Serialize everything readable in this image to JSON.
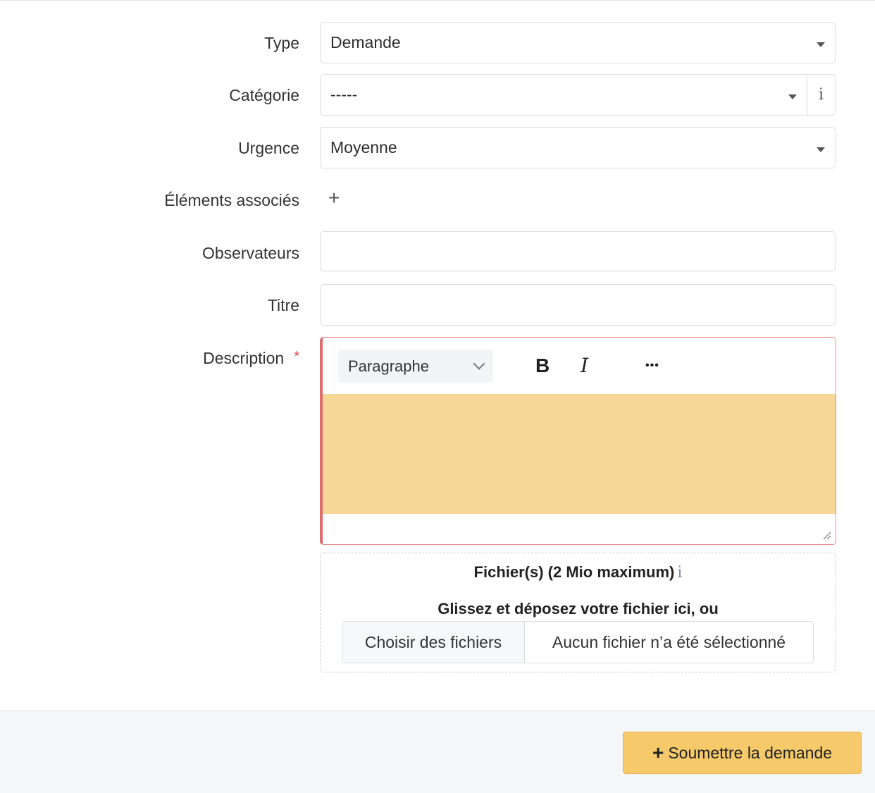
{
  "form": {
    "type_label": "Type",
    "type_value": "Demande",
    "category_label": "Catégorie",
    "category_value": "-----",
    "category_info": "i",
    "urgency_label": "Urgence",
    "urgency_value": "Moyenne",
    "linked_items_label": "Éléments associés",
    "linked_items_add": "+",
    "observers_label": "Observateurs",
    "observers_value": "",
    "title_label": "Titre",
    "title_value": "",
    "description_label": "Description",
    "required_mark": "*"
  },
  "editor": {
    "block_format": "Paragraphe",
    "bold": "B",
    "italic": "I",
    "more": "•••"
  },
  "upload": {
    "title": "Fichier(s) (2 Mio maximum)",
    "info": "i",
    "drop_text": "Glissez et déposez votre fichier ici, ou",
    "choose_button": "Choisir des fichiers",
    "no_file": "Aucun fichier n’a été sélectionné"
  },
  "footer": {
    "submit_icon": "+",
    "submit_label": "Soumettre la demande"
  },
  "colors": {
    "accent": "#f6c96a",
    "editor_fill": "#f6d797",
    "error_border": "#e06c6c"
  }
}
